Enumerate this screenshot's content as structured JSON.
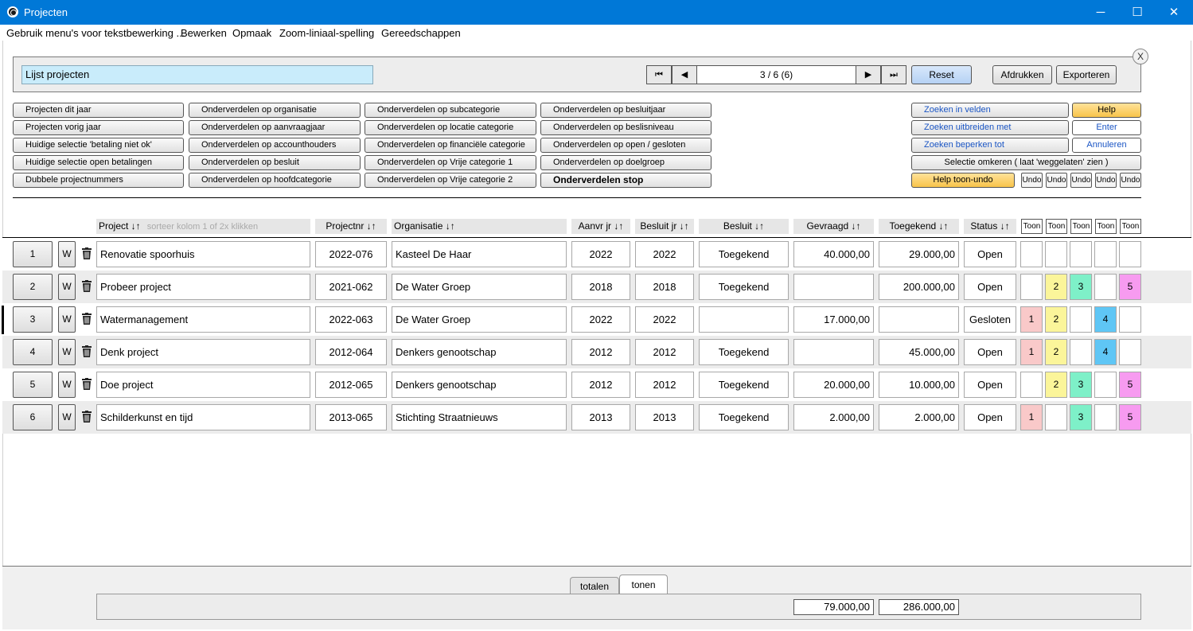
{
  "window": {
    "title": "Projecten",
    "minimize": "─",
    "maximize": "☐",
    "close": "✕"
  },
  "menu": [
    "Gebruik menu's voor tekstbewerking ...",
    "Bewerken",
    "Opmaak",
    "Zoom-liniaal-spelling",
    "Gereedschappen"
  ],
  "header": {
    "list_title": "Lijst projecten",
    "record_counter": "3 / 6 (6)",
    "nav": {
      "first": "⏮",
      "prev": "◀",
      "next": "▶",
      "last": "⏭"
    },
    "reset": "Reset",
    "print": "Afdrukken",
    "export": "Exporteren",
    "close": "X"
  },
  "commands": {
    "col1": [
      "Projecten dit jaar",
      "Projecten vorig jaar",
      "Huidige selectie 'betaling niet ok'",
      "Huidige selectie open betalingen",
      "Dubbele projectnummers"
    ],
    "col2": [
      "Onderverdelen op organisatie",
      "Onderverdelen op aanvraagjaar",
      "Onderverdelen op accounthouders",
      "Onderverdelen op besluit",
      "Onderverdelen op hoofdcategorie"
    ],
    "col3": [
      "Onderverdelen op subcategorie",
      "Onderverdelen op locatie categorie",
      "Onderverdelen op financiële categorie",
      "Onderverdelen op Vrije categorie 1",
      "Onderverdelen op Vrije categorie 2"
    ],
    "col4": [
      "Onderverdelen op besluitjaar",
      "Onderverdelen op beslisniveau",
      "Onderverdelen op open / gesloten",
      "Onderverdelen op doelgroep",
      "Onderverdelen stop"
    ],
    "search": [
      "Zoeken in velden",
      "Zoeken uitbreiden met",
      "Zoeken beperken tot"
    ],
    "help": "Help",
    "enter": "Enter",
    "cancel": "Annuleren",
    "invert": "Selectie omkeren ( laat 'weggelaten' zien )",
    "help_toggle": "Help toon-undo",
    "undo": "Undo"
  },
  "columns": {
    "project": "Project ↓↑",
    "sort_hint": "sorteer kolom 1 of 2x klikken",
    "projectnr": "Projectnr ↓↑",
    "organisatie": "Organisatie ↓↑",
    "aanvr": "Aanvr jr ↓↑",
    "besluitjr": "Besluit jr ↓↑",
    "besluit": "Besluit ↓↑",
    "gevraagd": "Gevraagd  ↓↑",
    "toegekend": "Toegekend  ↓↑",
    "status": "Status  ↓↑",
    "toon": "Toon"
  },
  "rows": [
    {
      "nr": "1",
      "w": "W",
      "project": "Renovatie spoorhuis",
      "projectnr": "2022-076",
      "organisatie": "Kasteel De Haar",
      "aanvr": "2022",
      "besluitjr": "2022",
      "besluit": "Toegekend",
      "gevraagd": "40.000,00",
      "toegekend": "29.000,00",
      "status": "Open",
      "tags": [
        "",
        "",
        "",
        "",
        ""
      ]
    },
    {
      "nr": "2",
      "w": "W",
      "project": "Probeer project",
      "projectnr": "2021-062",
      "organisatie": "De Water Groep",
      "aanvr": "2018",
      "besluitjr": "2018",
      "besluit": "Toegekend",
      "gevraagd": "",
      "toegekend": "200.000,00",
      "status": "Open",
      "tags": [
        "",
        "2",
        "3",
        "",
        "5"
      ]
    },
    {
      "nr": "3",
      "w": "W",
      "project": "Watermanagement",
      "projectnr": "2022-063",
      "organisatie": "De Water Groep",
      "aanvr": "2022",
      "besluitjr": "2022",
      "besluit": "",
      "gevraagd": "17.000,00",
      "toegekend": "",
      "status": "Gesloten",
      "tags": [
        "1",
        "2",
        "",
        "4",
        ""
      ]
    },
    {
      "nr": "4",
      "w": "W",
      "project": "Denk project",
      "projectnr": "2012-064",
      "organisatie": "Denkers genootschap",
      "aanvr": "2012",
      "besluitjr": "2012",
      "besluit": "Toegekend",
      "gevraagd": "",
      "toegekend": "45.000,00",
      "status": "Open",
      "tags": [
        "1",
        "2",
        "",
        "4",
        ""
      ]
    },
    {
      "nr": "5",
      "w": "W",
      "project": "Doe project",
      "projectnr": "2012-065",
      "organisatie": "Denkers genootschap",
      "aanvr": "2012",
      "besluitjr": "2012",
      "besluit": "Toegekend",
      "gevraagd": "20.000,00",
      "toegekend": "10.000,00",
      "status": "Open",
      "tags": [
        "",
        "2",
        "3",
        "",
        "5"
      ]
    },
    {
      "nr": "6",
      "w": "W",
      "project": "Schilderkunst en tijd",
      "projectnr": "2013-065",
      "organisatie": "Stichting Straatnieuws",
      "aanvr": "2013",
      "besluitjr": "2013",
      "besluit": "Toegekend",
      "gevraagd": "2.000,00",
      "toegekend": "2.000,00",
      "status": "Open",
      "tags": [
        "1",
        "",
        "3",
        "",
        "5"
      ]
    }
  ],
  "tag_colors": [
    "#f9c9c9",
    "#fbf59a",
    "#7ef0c8",
    "#5fc6f5",
    "#f79bf0"
  ],
  "footer": {
    "tabs": [
      "totalen",
      "tonen"
    ],
    "total_gevraagd": "79.000,00",
    "total_toegekend": "286.000,00"
  }
}
